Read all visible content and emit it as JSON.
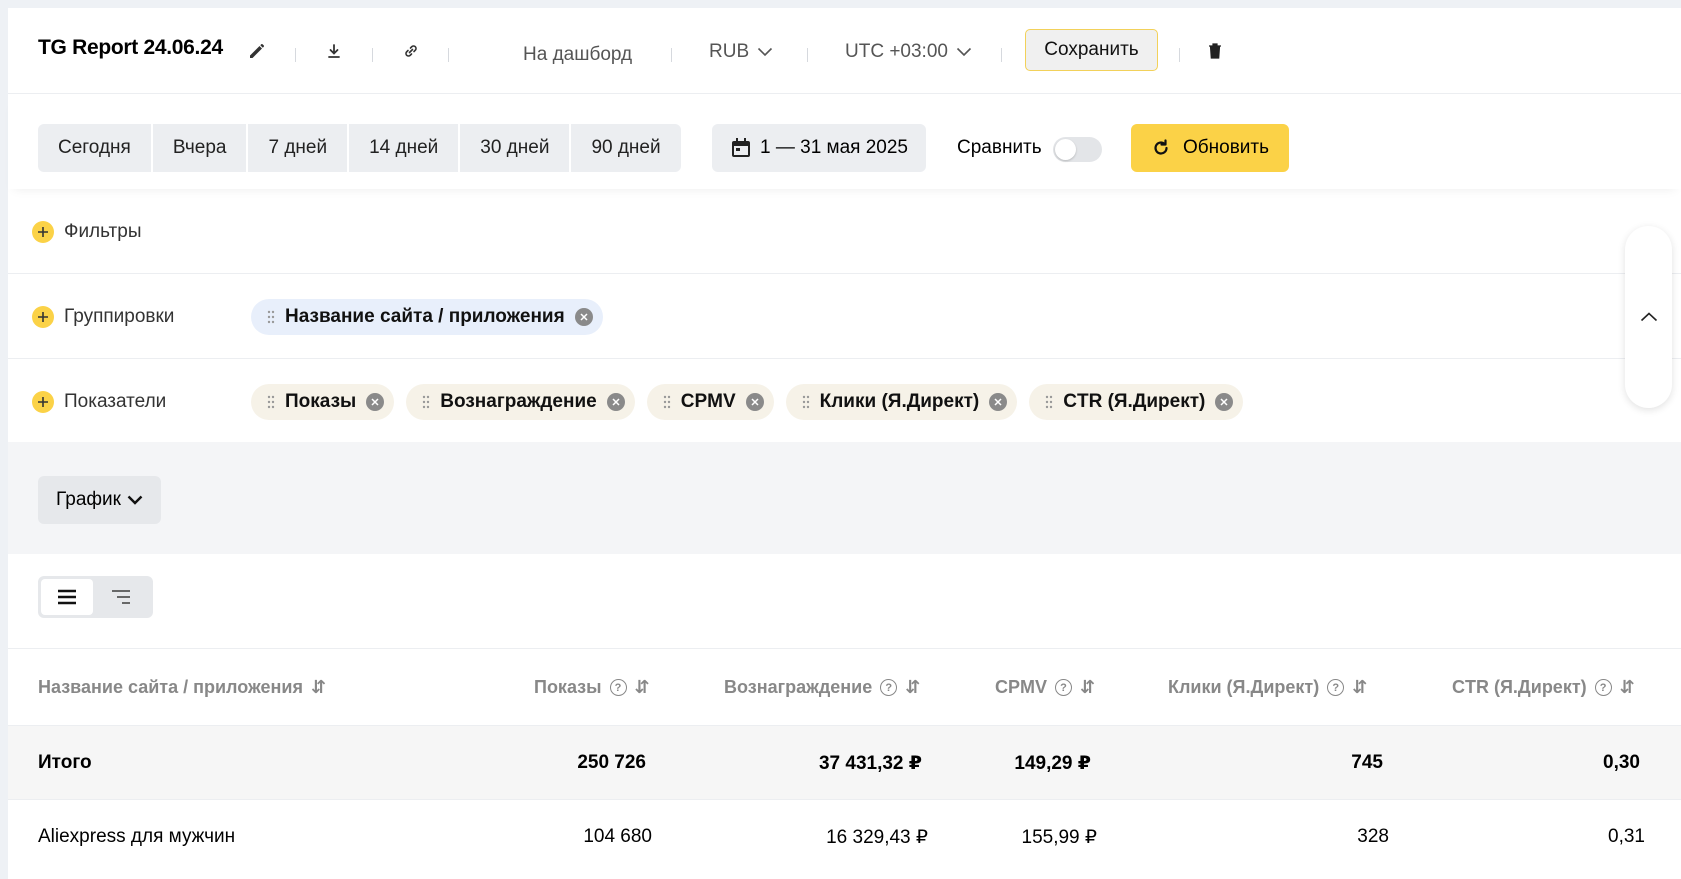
{
  "header": {
    "title": "TG Report 24.06.24",
    "to_dashboard": "На дашборд",
    "currency": "RUB",
    "timezone": "UTC +03:00",
    "save_label": "Сохранить"
  },
  "datebar": {
    "presets": [
      "Сегодня",
      "Вчера",
      "7 дней",
      "14 дней",
      "30 дней",
      "90 дней"
    ],
    "range": "1 — 31 мая 2025",
    "compare_label": "Сравнить",
    "compare_on": false,
    "refresh_label": "Обновить"
  },
  "filters": {
    "label": "Фильтры"
  },
  "groupings": {
    "label": "Группировки",
    "chips": [
      "Название сайта / приложения"
    ]
  },
  "metrics": {
    "label": "Показатели",
    "chips": [
      "Показы",
      "Вознаграждение",
      "CPMV",
      "Клики (Я.Директ)",
      "CTR (Я.Директ)"
    ]
  },
  "chart": {
    "button_label": "График"
  },
  "table": {
    "columns": [
      "Название сайта / приложения",
      "Показы",
      "Вознаграждение",
      "CPMV",
      "Клики (Я.Директ)",
      "CTR (Я.Директ)"
    ],
    "total": [
      "Итого",
      "250 726",
      "37 431,32 ₽",
      "149,29 ₽",
      "745",
      "0,30"
    ],
    "rows": [
      [
        "Aliexpress для мужчин",
        "104 680",
        "16 329,43 ₽",
        "155,99 ₽",
        "328",
        "0,31"
      ]
    ]
  },
  "colors": {
    "accent": "#fbd247",
    "grouping_chip": "#e8effb",
    "metric_chip": "#f6f2e8"
  }
}
